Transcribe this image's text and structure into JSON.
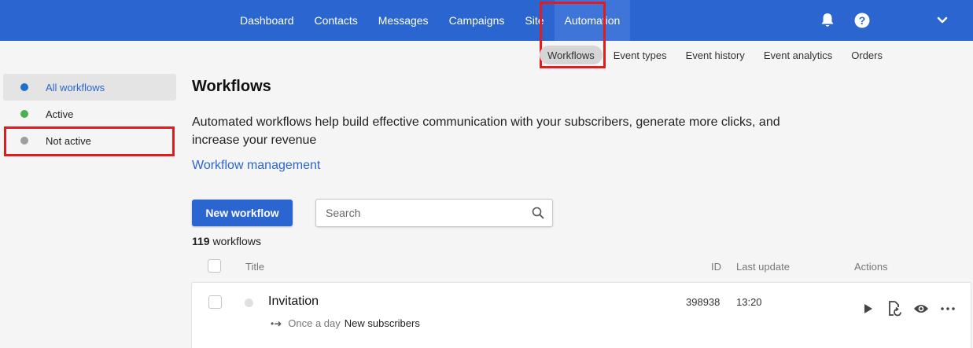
{
  "colors": {
    "primary": "#2b65d0",
    "highlight": "#e31b1b",
    "dot_all": "#1a73c7",
    "dot_active": "#4caf50",
    "dot_inactive": "#9e9e9e"
  },
  "topnav": {
    "items": [
      {
        "label": "Dashboard"
      },
      {
        "label": "Contacts"
      },
      {
        "label": "Messages"
      },
      {
        "label": "Campaigns"
      },
      {
        "label": "Site"
      },
      {
        "label": "Automation"
      }
    ],
    "active": "Automation",
    "icons": [
      "bell-icon",
      "help-icon",
      "chevron-down-icon"
    ]
  },
  "subnav": {
    "items": [
      {
        "label": "Workflows"
      },
      {
        "label": "Event types"
      },
      {
        "label": "Event history"
      },
      {
        "label": "Event analytics"
      },
      {
        "label": "Orders"
      }
    ],
    "active": "Workflows"
  },
  "sidebar": {
    "items": [
      {
        "label": "All workflows"
      },
      {
        "label": "Active"
      },
      {
        "label": "Not active"
      }
    ],
    "active": "All workflows"
  },
  "main": {
    "title": "Workflows",
    "description": "Automated workflows help build effective communication with your subscribers, generate more clicks, and increase your revenue",
    "link": "Workflow management",
    "new_button": "New workflow",
    "search_placeholder": "Search",
    "count_number": "119",
    "count_label": "workflows"
  },
  "table": {
    "headers": {
      "title": "Title",
      "id": "ID",
      "last_update": "Last update",
      "actions": "Actions"
    },
    "rows": [
      {
        "title": "Invitation",
        "frequency": "Once a day",
        "trigger": "New subscribers",
        "id": "398938",
        "last_update": "13:20",
        "actions": [
          "play-icon",
          "restore-icon",
          "eye-icon",
          "more-icon"
        ]
      }
    ]
  }
}
